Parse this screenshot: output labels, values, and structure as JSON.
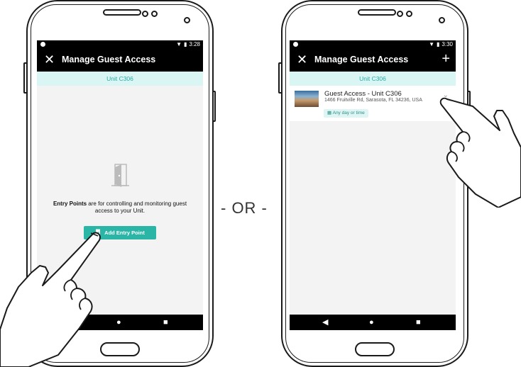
{
  "left_phone": {
    "status_time": "3:28",
    "appbar": {
      "close_icon": "close-icon",
      "title": "Manage Guest Access"
    },
    "unit_bar": "Unit C306",
    "empty_state": {
      "icon": "door-icon",
      "bold": "Entry Points",
      "text": " are for controlling and monitoring guest access to your Unit."
    },
    "add_button": {
      "icon": "door-icon",
      "label": "Add Entry Point"
    },
    "navbar": {
      "back": "◀",
      "home": "●",
      "recents": "■"
    }
  },
  "separator": "- OR -",
  "right_phone": {
    "status_time": "3:30",
    "appbar": {
      "close_icon": "close-icon",
      "title": "Manage Guest Access",
      "add_icon": "plus-icon"
    },
    "unit_bar": "Unit C306",
    "card": {
      "title": "Guest Access - Unit C306",
      "address": "1466 Fruitville Rd, Sarasota, FL 34236, USA",
      "schedule": "Any day or time",
      "schedule_icon": "calendar-icon",
      "expand_icon": "chevron-down-icon"
    },
    "navbar": {
      "back": "◀",
      "home": "●",
      "recents": "■"
    }
  },
  "colors": {
    "accent": "#2bb5a7",
    "unit_bar_bg": "#d9f6f5",
    "appbar_bg": "#000000"
  }
}
